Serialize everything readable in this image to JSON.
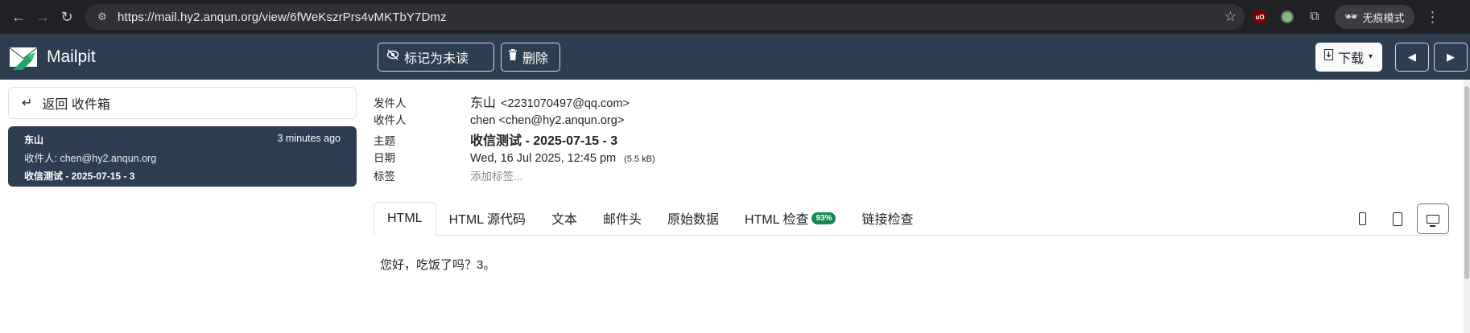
{
  "browser": {
    "url": "https://mail.hy2.anqun.org/view/6fWeKszrPrs4vMKTbY7Dmz",
    "incognito_label": "无痕模式",
    "ext_ub_label": "uO"
  },
  "header": {
    "brand": "Mailpit",
    "mark_unread": "标记为未读",
    "delete": "删除",
    "download": "下载"
  },
  "sidebar": {
    "back_label": "返回 收件箱",
    "message": {
      "from": "东山",
      "time": "3 minutes ago",
      "to": "收件人: chen@hy2.anqun.org",
      "subject": "收信测试 - 2025-07-15 - 3"
    }
  },
  "details": {
    "from_label": "发件人",
    "from_name": "东山",
    "from_email": "<2231070497@qq.com>",
    "to_label": "收件人",
    "to_value": "chen <chen@hy2.anqun.org>",
    "subject_label": "主题",
    "subject_value": "收信测试 - 2025-07-15 - 3",
    "date_label": "日期",
    "date_value": "Wed, 16 Jul 2025, 12:45 pm",
    "size": "(5.5 kB)",
    "tags_label": "标签",
    "tags_placeholder": "添加标签..."
  },
  "tabs": [
    {
      "label": "HTML"
    },
    {
      "label": "HTML 源代码"
    },
    {
      "label": "文本"
    },
    {
      "label": "邮件头"
    },
    {
      "label": "原始数据"
    },
    {
      "label": "HTML 检查",
      "badge": "93%"
    },
    {
      "label": "链接检查"
    }
  ],
  "body_text": "您好，吃饭了吗？3。",
  "colors": {
    "header_bg": "#2c3e50",
    "badge": "#198754"
  }
}
